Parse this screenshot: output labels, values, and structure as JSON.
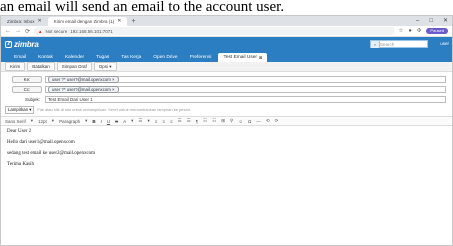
{
  "caption": "an email will send an email to the account user.",
  "browser": {
    "tabs": [
      {
        "label": "Zimbra: Inbox",
        "active": false
      },
      {
        "label": "Kirim email dengan Zimbra (1)",
        "active": true
      }
    ],
    "new_tab": "+",
    "window_controls": [
      "–",
      "□",
      "✕"
    ],
    "url_warning": "Not secure",
    "url": "192.168.56.101:7071",
    "extension_pill": "Paused"
  },
  "zimbra": {
    "logo": "zimbra",
    "search_placeholder": "Search",
    "user": "user",
    "tabs": [
      {
        "label": "Email",
        "active": false
      },
      {
        "label": "Kontak",
        "active": false
      },
      {
        "label": "Kalender",
        "active": false
      },
      {
        "label": "Tugas",
        "active": false
      },
      {
        "label": "Tas Kerja",
        "active": false
      },
      {
        "label": "Open Drive",
        "active": false
      },
      {
        "label": "Preferensi",
        "active": false
      },
      {
        "label": "Test Email User",
        "active": true
      }
    ],
    "toolbar": [
      "Kirim",
      "Batalkan",
      "Simpan Draf",
      "Opsi ▾"
    ],
    "to_button": "Ke:",
    "to_value": "user ?* user?@mail.openxcom ×",
    "cc_button": "Cc:",
    "cc_value": "user ?* user?@mail.openxcom ×",
    "subject_label": "Subjek:",
    "subject_value": "Test Email Dari User 1",
    "priority": "Lampirkan ▾",
    "attach_hint": "File atau klik di sini untuk melampirkan. Seret untuk menambahkan lampiran ke pesan.",
    "format_bar": [
      "Sans Serif",
      "▾",
      "12pt",
      "▾",
      "Paragraph",
      "▾",
      "B",
      "I",
      "U",
      "S",
      "A",
      "▾",
      "☰",
      "▾",
      "≡",
      "≡",
      "≡",
      "☰",
      "☰",
      "¶",
      "☷",
      "☷",
      "⊞",
      "⚲",
      "☺",
      "Ω",
      "—",
      "⟲",
      "⟳"
    ],
    "body": [
      "Dear User 2",
      "Hello dari user1@mail.openxcom",
      "sedang test email ke user2@mail.openxcom",
      "Terima Kasih"
    ]
  }
}
